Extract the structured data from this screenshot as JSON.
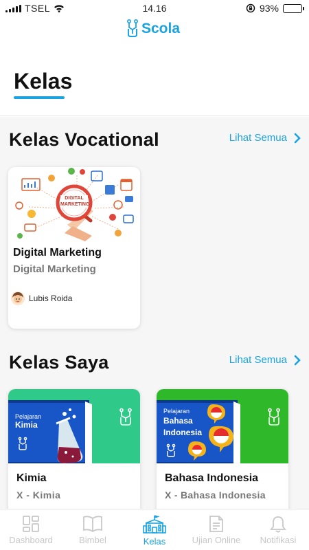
{
  "status_bar": {
    "carrier": "TSEL",
    "time": "14.16",
    "battery_percent": "93%",
    "battery_level": 0.93,
    "icons": [
      "signal-icon",
      "wifi-icon",
      "rotation-lock-icon",
      "battery-icon"
    ]
  },
  "header": {
    "logo_text": "Scola",
    "page_title": "Kelas"
  },
  "colors": {
    "accent": "#1aa3e0",
    "inactive": "#c8c8c8",
    "kimia_banner": "#2fc98a",
    "bahasa_banner": "#2fb82a"
  },
  "vocational": {
    "title": "Kelas Vocational",
    "see_all": "Lihat Semua",
    "cards": [
      {
        "banner_text": "DIGITAL MARKETING",
        "title": "Digital Marketing",
        "subtitle": "Digital Marketing",
        "author": "Lubis Roida"
      }
    ]
  },
  "my_classes": {
    "title": "Kelas Saya",
    "see_all": "Lihat Semua",
    "cards": [
      {
        "book_label": "Pelajaran",
        "book_subject": "Kimia",
        "title": "Kimia",
        "subtitle": "X - Kimia"
      },
      {
        "book_label": "Pelajaran",
        "book_subject_line1": "Bahasa",
        "book_subject_line2": "Indonesia",
        "title": "Bahasa Indonesia",
        "subtitle": "X - Bahasa Indonesia"
      }
    ]
  },
  "bottom_nav": {
    "items": [
      {
        "label": "Dashboard",
        "icon": "dashboard-icon",
        "active": false
      },
      {
        "label": "Bimbel",
        "icon": "book-icon",
        "active": false
      },
      {
        "label": "Kelas",
        "icon": "school-icon",
        "active": true
      },
      {
        "label": "Ujian Online",
        "icon": "exam-icon",
        "active": false
      },
      {
        "label": "Notifikasi",
        "icon": "bell-icon",
        "active": false
      }
    ]
  }
}
